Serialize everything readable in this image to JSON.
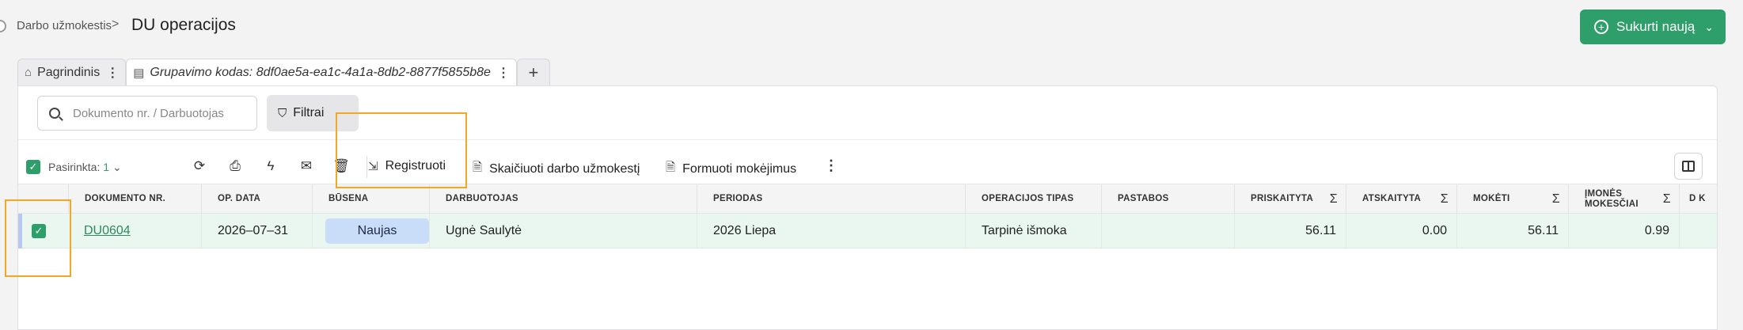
{
  "breadcrumb": {
    "parent": "Darbo užmokestis",
    "separator": ">"
  },
  "page_title": "DU operacijos",
  "create_button": {
    "label": "Sukurti naują"
  },
  "tabs": [
    {
      "label": "Pagrindinis",
      "icon": "home-icon"
    },
    {
      "label": "Grupavimo kodas: 8df0ae5a-ea1c-4a1a-8db2-8877f5855b8e",
      "icon": "table-icon"
    }
  ],
  "search": {
    "placeholder": "Dokumento nr. / Darbuotojas"
  },
  "filter_button": {
    "label": "Filtrai"
  },
  "toolbar": {
    "selected_label": "Pasirinkta:",
    "selected_count": "1",
    "actions": {
      "register": "Registruoti",
      "calc_salary": "Skaičiuoti darbo užmokestį",
      "form_payments": "Formuoti mokėjimus"
    }
  },
  "table": {
    "columns": {
      "doc_nr": "DOKUMENTO NR.",
      "op_date": "OP. DATA",
      "status": "BŪSENA",
      "employee": "DARBUOTOJAS",
      "period": "PERIODAS",
      "op_type": "OPERACIJOS TIPAS",
      "notes": "PASTABOS",
      "assigned": "PRISKAITYTA",
      "deducted": "ATSKAITYTA",
      "payable": "MOKĖTI",
      "company_taxes": "ĮMONĖS MOKESČIAI",
      "cut_off": "D K"
    },
    "sum_symbol": "Σ",
    "rows": [
      {
        "doc_nr": "DU0604",
        "op_date": "2026–07–31",
        "status": "Naujas",
        "employee": "Ugnė Saulytė",
        "period": "2026 Liepa",
        "op_type": "Tarpinė išmoka",
        "notes": "",
        "assigned": "56.11",
        "deducted": "0.00",
        "payable": "56.11",
        "company_taxes": "0.99"
      }
    ]
  },
  "colors": {
    "accent": "#2e9e6a",
    "highlight": "#f5a623",
    "status_badge": "#c9dcf8",
    "row_selected": "#eaf6f0"
  }
}
